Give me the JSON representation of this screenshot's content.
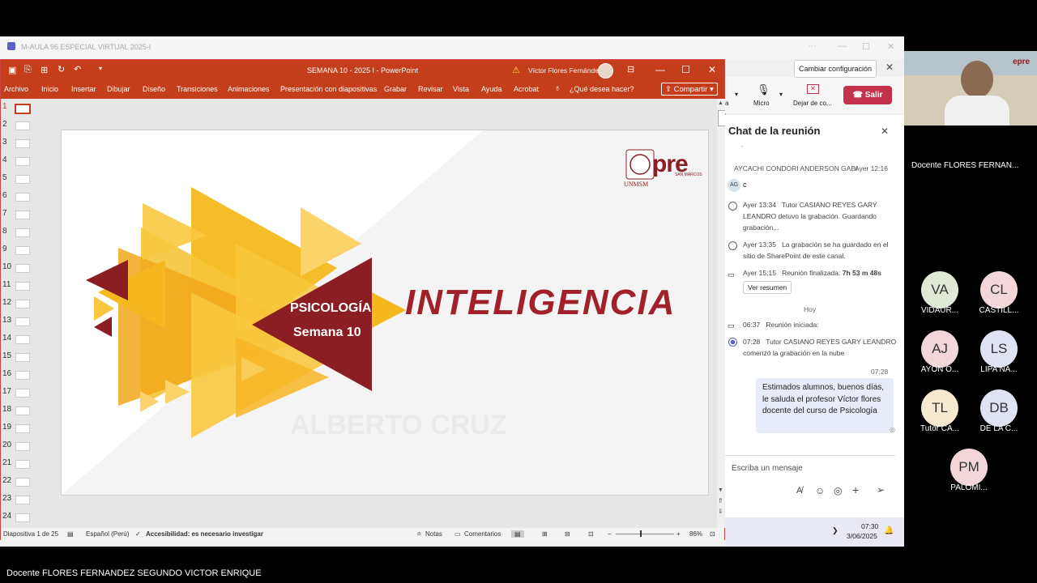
{
  "teams": {
    "window_title": "M-AULA 96 ESPECIAL VIRTUAL 2025-I",
    "presenter_caption": "Docente FLORES FERNANDEZ SEGUNDO VICTOR ENRIQUE",
    "video_label": "Docente FLORES FERNAN..."
  },
  "ppt": {
    "title": "SEMANA 10 - 2025 I  -  PowerPoint",
    "user": "Víctor Flores Fernández",
    "menu": [
      "Archivo",
      "Inicio",
      "Insertar",
      "Dibujar",
      "Diseño",
      "Transiciones",
      "Animaciones",
      "Presentación con diapositivas",
      "Grabar",
      "Revisar",
      "Vista",
      "Ayuda",
      "Acrobat"
    ],
    "tell_me": "¿Qué desea hacer?",
    "share": "Compartir",
    "slide_numbers": [
      "1",
      "2",
      "3",
      "4",
      "5",
      "6",
      "7",
      "8",
      "9",
      "10",
      "11",
      "12",
      "13",
      "14",
      "15",
      "16",
      "17",
      "18",
      "19",
      "20",
      "21",
      "22",
      "23",
      "24"
    ],
    "status": {
      "slide": "Diapositiva 1 de 25",
      "lang": "Español (Perú)",
      "access": "Accesibilidad: es necesario investigar",
      "notes": "Notas",
      "comments": "Comentarios",
      "zoom": "86%"
    }
  },
  "slide": {
    "logo_text": "pre",
    "logo_sub": "SAN MARCOS",
    "logo_inst": "UNMSM",
    "subject": "PSICOLOGÍA",
    "week": "Semana 10",
    "headline": "INTELIGENCIA",
    "watermark": "ALBERTO CRUZ"
  },
  "controls": {
    "cambiar": "Cambiar configuración",
    "micro": "Micro",
    "dejar": "Dejar de co...",
    "salir": "Salir",
    "left_cut": "a"
  },
  "chat": {
    "title": "Chat de la reunión",
    "top_fragment": "-",
    "sender": "AYCACHI CONDORI ANDERSON GABI",
    "sender_time": "Ayer 12:16",
    "sender_avatar": "AG",
    "sender_msg": "c",
    "events": [
      {
        "time": "Ayer 13:34",
        "text": "Tutor CASIANO REYES GARY LEANDRO detuvo la grabación. Guardando grabación..."
      },
      {
        "time": "Ayer 13:35",
        "text": "La grabación se ha guardado en el sitio de SharePoint de este canal."
      },
      {
        "time": "Ayer 15:15",
        "text": "Reunión finalizada:",
        "bold": "7h 53 m 48s"
      }
    ],
    "summary_btn": "Ver resumen",
    "today": "Hoy",
    "events2": [
      {
        "time": "06:37",
        "text": "Reunión iniciada:"
      },
      {
        "time": "07:28",
        "text": "Tutor CASIANO REYES GARY LEANDRO comenzó la grabación en la nube"
      }
    ],
    "msg_time": "07:28",
    "msg": "Estimados alumnos, buenos días, le saluda el profesor Víctor flores docente del curso de Psicología",
    "compose_placeholder": "Escriba un mensaje"
  },
  "taskbar": {
    "time": "07:30",
    "date": "3/06/2025"
  },
  "participants": [
    {
      "initials": "VA",
      "name": "VIDAUR...",
      "color": "#dfe9d6"
    },
    {
      "initials": "CL",
      "name": "CASTILL...",
      "color": "#f3d6da"
    },
    {
      "initials": "AJ",
      "name": "AYÓN O...",
      "color": "#f3d6da"
    },
    {
      "initials": "LS",
      "name": "LIPA NA...",
      "color": "#dfe3f3"
    },
    {
      "initials": "TL",
      "name": "Tutor CA...",
      "color": "#f5ead0"
    },
    {
      "initials": "DB",
      "name": "DE LA C...",
      "color": "#dfe3f3"
    },
    {
      "initials": "PM",
      "name": "PALOMI...",
      "color": "#f3d6da"
    }
  ],
  "colors": {
    "ppt_red": "#c43e1c",
    "maroon": "#8b1e22",
    "yellow": "#f5b91f",
    "salir": "#c4314b"
  }
}
